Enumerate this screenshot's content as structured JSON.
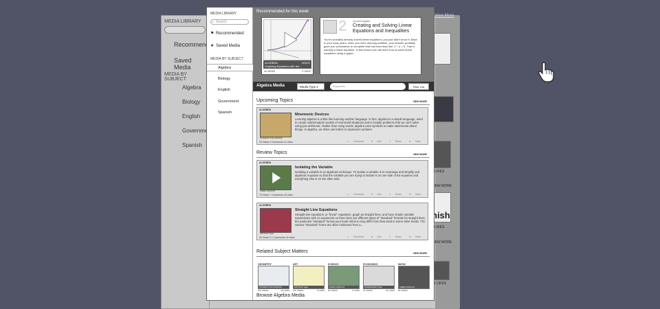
{
  "background": {
    "sidebar_caption": "MEDIA LIBRARY",
    "search_placeholder": "Search",
    "nav": [
      "Recommended",
      "Saved Media"
    ],
    "by_subject": "MEDIA BY SUBJECT",
    "subjects": [
      "Algebra",
      "Biology",
      "English",
      "Government",
      "Spanish"
    ],
    "view_more": "View More",
    "frag_likes_1": "3 LIKES",
    "frag_likes_2": "5 LIKES",
    "frag_view_more_1": "VIEW MORE",
    "frag_view_more_2": "VIEW MORE",
    "frag_nish": "nish",
    "frag_likes_3": "51 LIKES"
  },
  "sidebar": {
    "caption": "MEDIA LIBRARY",
    "search_placeholder": "Search",
    "nav": [
      {
        "label": "Recommended",
        "icon": "flag-icon"
      },
      {
        "label": "Saved Media",
        "icon": "star-icon"
      }
    ],
    "by_subject": "MEDIA BY SUBJECT",
    "subjects": [
      "Algebra",
      "Biology",
      "English",
      "Government",
      "Spanish"
    ],
    "selected_subject": "Algebra"
  },
  "hero": {
    "title": "Recommended for this week",
    "video": {
      "category": "ALGEBRA",
      "length": "VIDEO",
      "title": "Graphing Equations with the...",
      "views": "44 VIEWS",
      "likes": "2 LIKES"
    },
    "chapter": {
      "number": "2",
      "label": "Current Chapter",
      "title": "Creating and Solving Linear Equations and Inequalities",
      "body": "You've probably already solved linear equations; you just didn't know it. Back in your early years, when you were learning addition, your teacher probably gave you worksheets to complete that had exercises like: 2 + a = 5. That is actually a linear equation. In this lesson you will learn how to solve linear equations using a graph."
    }
  },
  "toolbar": {
    "title": "Algebra Media",
    "media_type": "Media Type",
    "keyword_placeholder": "Keywords",
    "filter": "Filter List"
  },
  "upcoming": {
    "heading": "Upcoming Topics",
    "view_more": "VIEW MORE",
    "cards": [
      {
        "tag": "ALGEBRA",
        "title": "Mnemonic Devices",
        "body": "Learning algebra is a little like learning another language. In fact, algebra is a simple language, used to create mathematical models of real-world situations and to handle problems that we can't solve using just arithmetic. Rather than using words, algebra uses symbols to make statements about things. In algebra, we often use letters to represent numbers.",
        "type": "INTERACTIVE LESSON",
        "stats": "33 Views   2 Comments   11 Likes"
      }
    ]
  },
  "review": {
    "heading": "Review Topics",
    "view_more": "VIEW MORE",
    "cards": [
      {
        "tag": "ALGEBRA",
        "title": "Isolating the Variable",
        "body": "Isolating a variable is an algebraic technique. To isolate a variable is to rearrange and simplify and algebraic equation so that the variable you are trying to isolate is on one side of the equation and everything else is on the other side.",
        "type": "VIDEO 00:00:00",
        "stats": "73 Views   7 Comments   49 Likes"
      },
      {
        "tag": "ALGEBRA",
        "title": "Straight Line Equations",
        "body": "Straight-line equations, or \"linear\" equations, graph as straight lines, and have simple variable expressions with no exponents on them.here are different types of \"standard\" formats for straight lines; the particular \"standard\" format your book refers to may differ from that used in some other books. The various \"standard\" forms are often holdovers from a...",
        "type": "ARTICLE Toga",
        "stats": "40 Views   2 1 Comments   16 Likes"
      }
    ]
  },
  "actions": [
    "Comment",
    "Like",
    "Share",
    "Save"
  ],
  "related": {
    "heading": "Related Subject Matters",
    "view_more": "VIEW MORE",
    "items": [
      {
        "label": "GEOMETRY",
        "caption": "INTERACTIVE LESSON",
        "views": "575 VIEWS",
        "likes": "10 LIKES",
        "color": "#e8ecf0"
      },
      {
        "label": "ART",
        "caption": "ARTICLE Toga",
        "views": "706 VIEWS",
        "likes": "3 LIKES",
        "color": "#f2f0c0"
      },
      {
        "label": "SCIENCE",
        "caption": "AUDIO 00:06:14",
        "views": "99 VIEWS",
        "likes": "4 LIKES",
        "color": "#7a9a7a"
      },
      {
        "label": "ECONOMICS",
        "caption": "SLIDESHOW Toga",
        "views": "21 VIEWS",
        "likes": "51 LIKES",
        "color": "#dadada"
      },
      {
        "label": "MUSIC",
        "caption": "VIDEO 00:04:14",
        "views": "49 VIEWS",
        "likes": "",
        "color": "#555555"
      }
    ]
  },
  "browse": {
    "heading": "Browse Algebra Media"
  }
}
